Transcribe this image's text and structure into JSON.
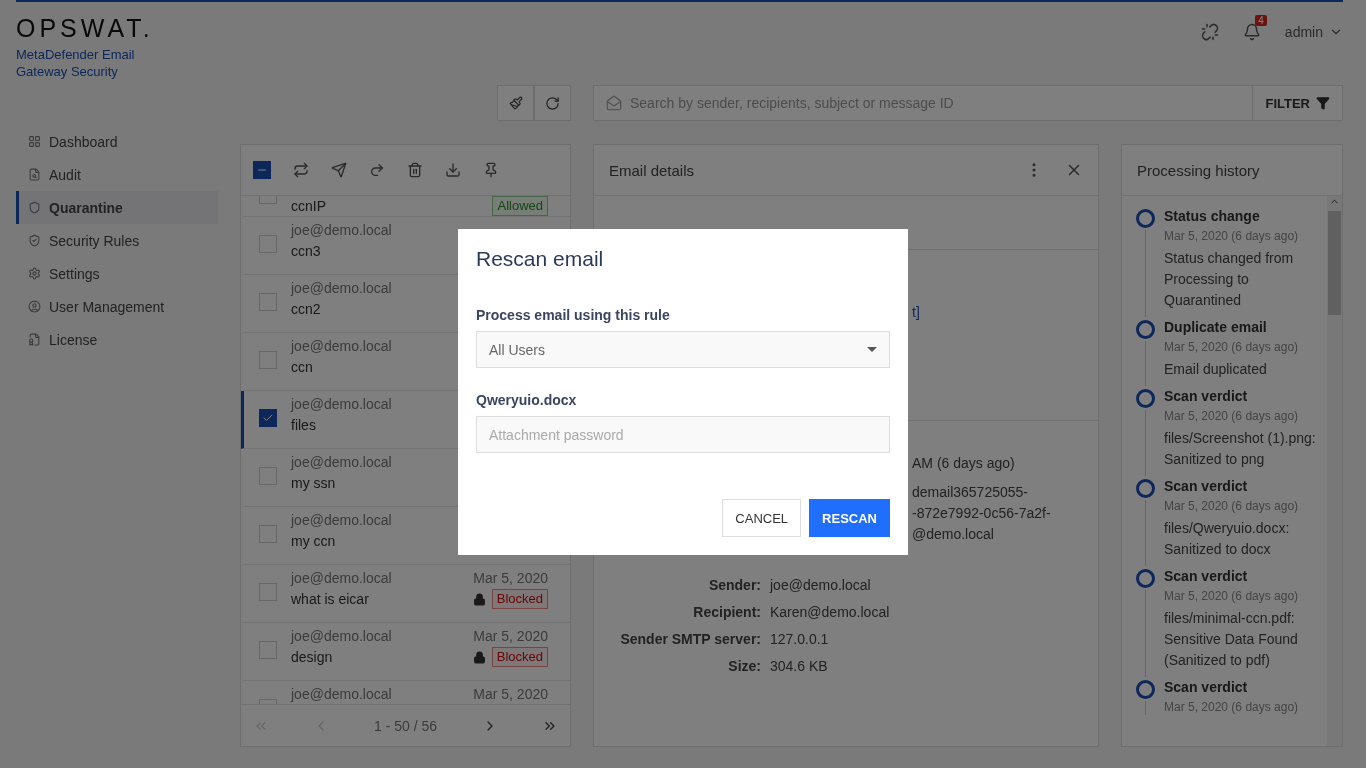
{
  "brand": {
    "logo": "OPSWAT.",
    "product": "MetaDefender Email Gateway Security"
  },
  "header": {
    "notifications": "4",
    "user": "admin"
  },
  "sidebar": {
    "items": [
      {
        "label": "Dashboard",
        "selected": false
      },
      {
        "label": "Audit",
        "selected": false
      },
      {
        "label": "Quarantine",
        "selected": true
      },
      {
        "label": "Security Rules",
        "selected": false
      },
      {
        "label": "Settings",
        "selected": false
      },
      {
        "label": "User Management",
        "selected": false
      },
      {
        "label": "License",
        "selected": false
      }
    ]
  },
  "search": {
    "placeholder": "Search by sender, recipients, subject or message ID",
    "filter": "FILTER"
  },
  "list": {
    "select_all_indeterminate": true,
    "rows": [
      {
        "subject": "ccnIP",
        "status": "Allowed",
        "kind": "partial",
        "checked": false,
        "selected": false
      },
      {
        "sender": "joe@demo.local",
        "subject": "ccn3",
        "checked": false,
        "selected": false
      },
      {
        "sender": "joe@demo.local",
        "subject": "ccn2",
        "checked": false,
        "selected": false
      },
      {
        "sender": "joe@demo.local",
        "subject": "ccn",
        "checked": false,
        "selected": false
      },
      {
        "sender": "joe@demo.local",
        "subject": "files",
        "checked": true,
        "selected": true
      },
      {
        "sender": "joe@demo.local",
        "subject": "my ssn",
        "checked": false,
        "selected": false
      },
      {
        "sender": "joe@demo.local",
        "subject": "my ccn",
        "checked": false,
        "selected": false
      },
      {
        "sender": "joe@demo.local",
        "subject": "what is eicar",
        "date": "Mar 5, 2020",
        "status": "Blocked",
        "locked": true,
        "checked": false,
        "selected": false
      },
      {
        "sender": "joe@demo.local",
        "subject": "design",
        "date": "Mar 5, 2020",
        "status": "Blocked",
        "locked": true,
        "checked": false,
        "selected": false
      },
      {
        "sender": "joe@demo.local",
        "date": "Mar 5, 2020",
        "checked": false,
        "selected": false
      }
    ],
    "pagination": "1 - 50 / 56"
  },
  "details": {
    "title": "Email details",
    "link_fragment": "t]",
    "fields": [
      {
        "kind": "fragment",
        "value": "AM (6 days ago)"
      },
      {
        "kind": "fragment",
        "value": "demail365725055-"
      },
      {
        "kind": "fragment",
        "value": "-872e7992-0c56-7a2f-"
      },
      {
        "kind": "fragment",
        "value": "@demo.local"
      },
      {
        "kind": "field",
        "label": "Sender:",
        "value": "joe@demo.local"
      },
      {
        "kind": "field",
        "label": "Recipient:",
        "value": "Karen@demo.local"
      },
      {
        "kind": "field",
        "label": "Sender SMTP server:",
        "value": "127.0.0.1"
      },
      {
        "kind": "field",
        "label": "Size:",
        "value": "304.6 KB"
      }
    ]
  },
  "history": {
    "title": "Processing history",
    "items": [
      {
        "title": "Status change",
        "date": "Mar 5, 2020 (6 days ago)",
        "text": "Status changed from Processing to Quarantined"
      },
      {
        "title": "Duplicate email",
        "date": "Mar 5, 2020 (6 days ago)",
        "text": "Email duplicated"
      },
      {
        "title": "Scan verdict",
        "date": "Mar 5, 2020 (6 days ago)",
        "text": "files/Screenshot (1).png: Sanitized to png"
      },
      {
        "title": "Scan verdict",
        "date": "Mar 5, 2020 (6 days ago)",
        "text": "files/Qweryuio.docx: Sanitized to docx"
      },
      {
        "title": "Scan verdict",
        "date": "Mar 5, 2020 (6 days ago)",
        "text": "files/minimal-ccn.pdf: Sensitive Data Found (Sanitized to pdf)"
      },
      {
        "title": "Scan verdict",
        "date": "Mar 5, 2020 (6 days ago)"
      }
    ]
  },
  "dialog": {
    "title": "Rescan email",
    "rule_label": "Process email using this rule",
    "rule_value": "All Users",
    "attachment_label": "Qweryuio.docx",
    "password_placeholder": "Attachment password",
    "buttons": [
      {
        "label": "CANCEL",
        "kind": "secondary"
      },
      {
        "label": "RESCAN",
        "kind": "primary"
      }
    ]
  }
}
